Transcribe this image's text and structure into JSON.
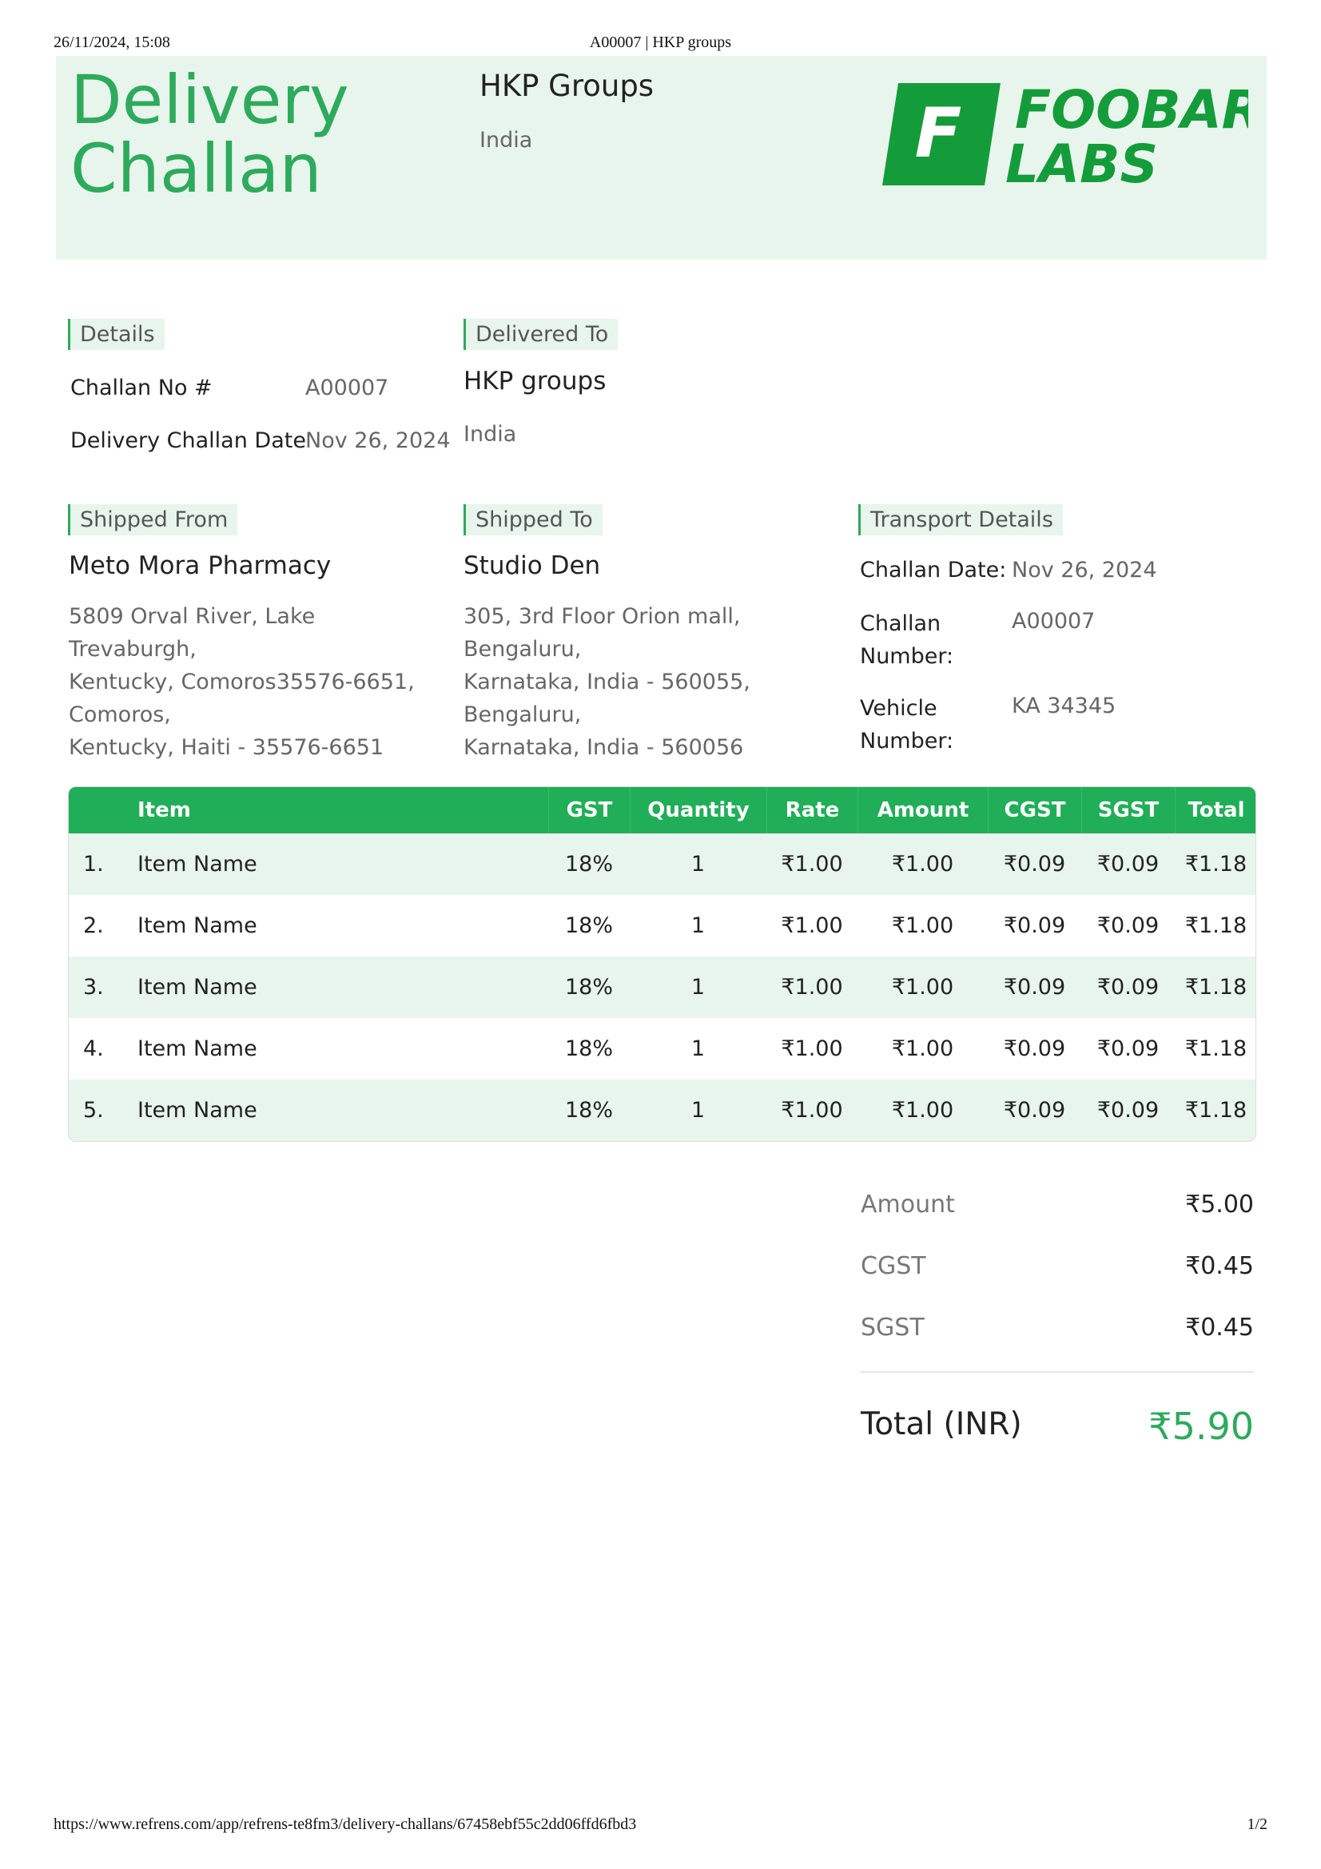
{
  "print_header": {
    "date": "26/11/2024, 15:08",
    "title": "A00007 | HKP groups"
  },
  "print_footer": {
    "url": "https://www.refrens.com/app/refrens-te8fm3/delivery-challans/67458ebf55c2dd06ffd6fbd3",
    "page": "1/2"
  },
  "header": {
    "title_line1": "Delivery",
    "title_line2": "Challan",
    "from_name": "HKP Groups",
    "from_country": "India",
    "logo_text_line1": "FOOBAR",
    "logo_text_line2": "LABS",
    "logo_mark": "F"
  },
  "details": {
    "tag": "Details",
    "challan_no_label": "Challan No #",
    "challan_no": "A00007",
    "date_label": "Delivery Challan Date",
    "date": "Nov 26, 2024"
  },
  "delivered_to": {
    "tag": "Delivered To",
    "name": "HKP groups",
    "country": "India"
  },
  "shipped_from": {
    "tag": "Shipped From",
    "name": "Meto Mora Pharmacy",
    "address": [
      "5809 Orval River, Lake Trevaburgh,",
      "Kentucky, Comoros35576-6651,",
      "Comoros,",
      "Kentucky, Haiti - 35576-6651"
    ]
  },
  "shipped_to": {
    "tag": "Shipped To",
    "name": "Studio Den",
    "address": [
      "305, 3rd Floor Orion mall, Bengaluru,",
      "Karnataka, India - 560055,",
      "Bengaluru,",
      "Karnataka, India - 560056"
    ]
  },
  "transport": {
    "tag": "Transport Details",
    "challan_date_label": "Challan Date:",
    "challan_date": "Nov 26, 2024",
    "challan_number_label_1": "Challan",
    "challan_number_label_2": "Number:",
    "challan_number": "A00007",
    "vehicle_label_1": "Vehicle",
    "vehicle_label_2": "Number:",
    "vehicle_number": "KA 34345"
  },
  "table": {
    "columns": [
      "Item",
      "GST",
      "Quantity",
      "Rate",
      "Amount",
      "CGST",
      "SGST",
      "Total"
    ],
    "rows": [
      {
        "index": "1.",
        "item": "Item Name",
        "gst": "18%",
        "qty": "1",
        "rate": "₹1.00",
        "amount": "₹1.00",
        "cgst": "₹0.09",
        "sgst": "₹0.09",
        "total": "₹1.18"
      },
      {
        "index": "2.",
        "item": "Item Name",
        "gst": "18%",
        "qty": "1",
        "rate": "₹1.00",
        "amount": "₹1.00",
        "cgst": "₹0.09",
        "sgst": "₹0.09",
        "total": "₹1.18"
      },
      {
        "index": "3.",
        "item": "Item Name",
        "gst": "18%",
        "qty": "1",
        "rate": "₹1.00",
        "amount": "₹1.00",
        "cgst": "₹0.09",
        "sgst": "₹0.09",
        "total": "₹1.18"
      },
      {
        "index": "4.",
        "item": "Item Name",
        "gst": "18%",
        "qty": "1",
        "rate": "₹1.00",
        "amount": "₹1.00",
        "cgst": "₹0.09",
        "sgst": "₹0.09",
        "total": "₹1.18"
      },
      {
        "index": "5.",
        "item": "Item Name",
        "gst": "18%",
        "qty": "1",
        "rate": "₹1.00",
        "amount": "₹1.00",
        "cgst": "₹0.09",
        "sgst": "₹0.09",
        "total": "₹1.18"
      }
    ]
  },
  "summary": {
    "amount_label": "Amount",
    "amount": "₹5.00",
    "cgst_label": "CGST",
    "cgst": "₹0.45",
    "sgst_label": "SGST",
    "sgst": "₹0.45",
    "total_label": "Total (INR)",
    "total": "₹5.90"
  },
  "colors": {
    "accent": "#2daa5c",
    "table_header": "#21ae58",
    "tint": "#e8f5ec",
    "logo_green": "#149c3a"
  }
}
